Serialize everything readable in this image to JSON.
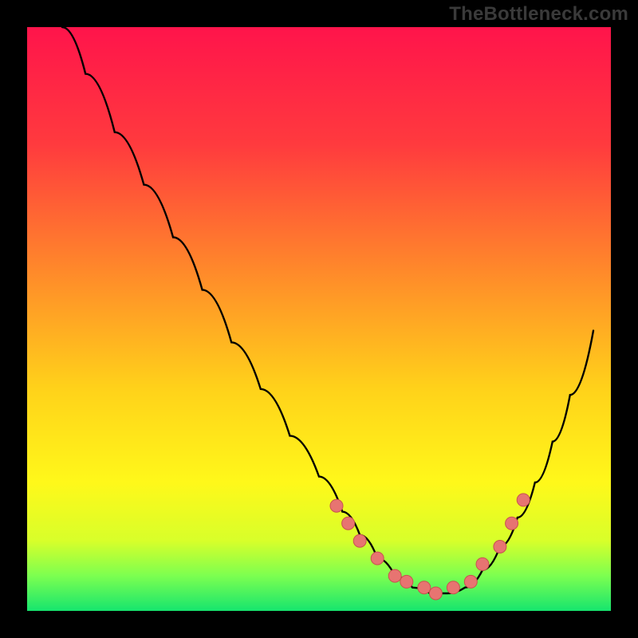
{
  "watermark": "TheBottleneck.com",
  "colors": {
    "black": "#000000",
    "gradient_stops": [
      {
        "offset": 0.0,
        "color": "#ff144b"
      },
      {
        "offset": 0.2,
        "color": "#ff3a3e"
      },
      {
        "offset": 0.42,
        "color": "#ff8a2a"
      },
      {
        "offset": 0.62,
        "color": "#ffd21a"
      },
      {
        "offset": 0.78,
        "color": "#fff81a"
      },
      {
        "offset": 0.88,
        "color": "#d8ff2a"
      },
      {
        "offset": 0.94,
        "color": "#7cff50"
      },
      {
        "offset": 1.0,
        "color": "#16e56e"
      }
    ],
    "curve": "#000000",
    "dot_fill": "#e77471",
    "dot_stroke": "#c9524f"
  },
  "chart_data": {
    "type": "line",
    "title": "",
    "xlabel": "",
    "ylabel": "",
    "xlim": [
      0,
      100
    ],
    "ylim": [
      0,
      100
    ],
    "series": [
      {
        "name": "bottleneck-curve",
        "x": [
          6,
          10,
          15,
          20,
          25,
          30,
          35,
          40,
          45,
          50,
          54,
          57,
          60,
          63,
          66,
          69,
          72,
          75,
          78,
          81,
          84,
          87,
          90,
          93,
          97
        ],
        "y": [
          100,
          92,
          82,
          73,
          64,
          55,
          46,
          38,
          30,
          23,
          17,
          13,
          9,
          6,
          4,
          3,
          3,
          4,
          7,
          11,
          16,
          22,
          29,
          37,
          48
        ]
      }
    ],
    "dots": {
      "name": "highlight-points",
      "x": [
        53,
        55,
        57,
        60,
        63,
        65,
        68,
        70,
        73,
        76,
        78,
        81,
        83,
        85
      ],
      "y": [
        18,
        15,
        12,
        9,
        6,
        5,
        4,
        3,
        4,
        5,
        8,
        11,
        15,
        19
      ]
    }
  }
}
